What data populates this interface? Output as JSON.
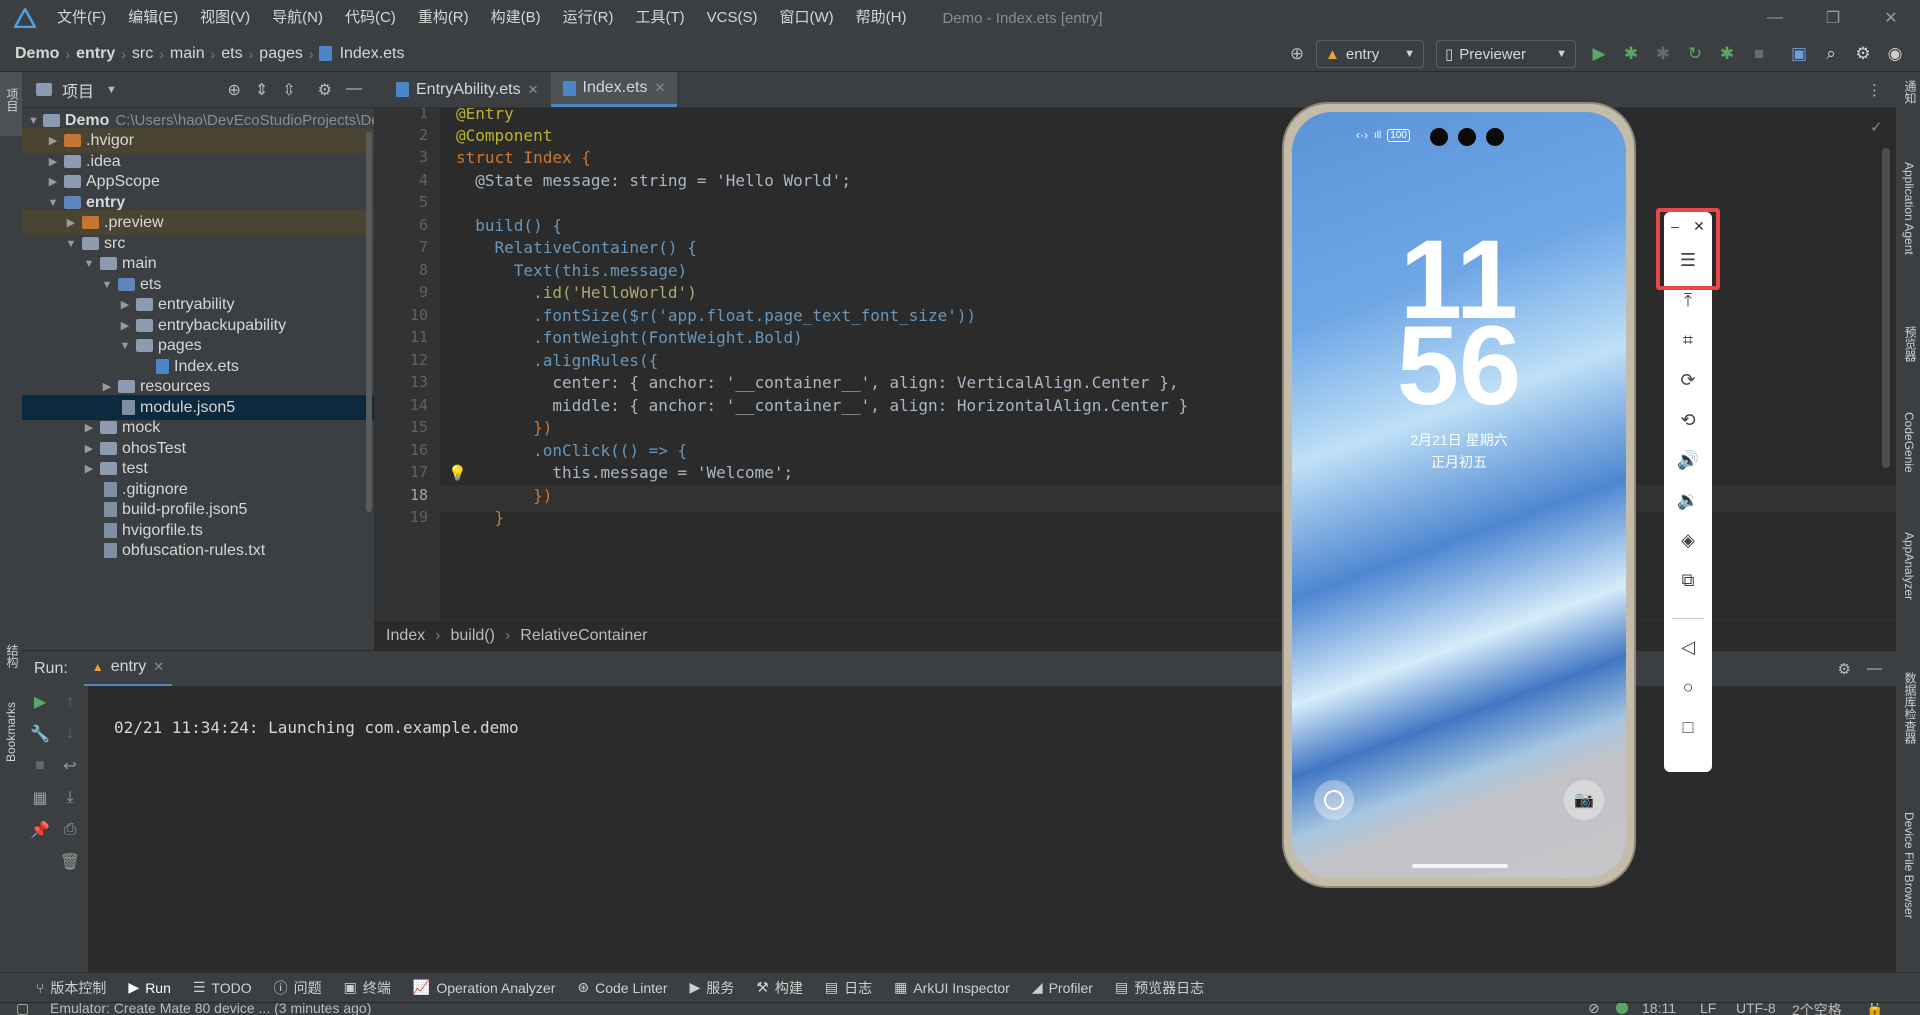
{
  "titlebar": {
    "menu": [
      "文件(F)",
      "编辑(E)",
      "视图(V)",
      "导航(N)",
      "代码(C)",
      "重构(R)",
      "构建(B)",
      "运行(R)",
      "工具(T)",
      "VCS(S)",
      "窗口(W)",
      "帮助(H)"
    ],
    "window_title": "Demo - Index.ets [entry]"
  },
  "navbar": {
    "crumbs": [
      "Demo",
      "entry",
      "src",
      "main",
      "ets",
      "pages",
      "Index.ets"
    ],
    "module": "entry",
    "device": "Previewer"
  },
  "project": {
    "title": "项目",
    "tree": [
      {
        "name": "Demo",
        "path": "C:\\Users\\hao\\DevEcoStudioProjects\\Demo"
      },
      {
        "name": ".hvigor"
      },
      {
        "name": ".idea"
      },
      {
        "name": "AppScope"
      },
      {
        "name": "entry"
      },
      {
        "name": ".preview"
      },
      {
        "name": "src"
      },
      {
        "name": "main"
      },
      {
        "name": "ets"
      },
      {
        "name": "entryability"
      },
      {
        "name": "entrybackupability"
      },
      {
        "name": "pages"
      },
      {
        "name": "Index.ets"
      },
      {
        "name": "resources"
      },
      {
        "name": "module.json5"
      },
      {
        "name": "mock"
      },
      {
        "name": "ohosTest"
      },
      {
        "name": "test"
      },
      {
        "name": ".gitignore"
      },
      {
        "name": "build-profile.json5"
      },
      {
        "name": "hvigorfile.ts"
      },
      {
        "name": "obfuscation-rules.txt"
      }
    ]
  },
  "tabs": [
    "EntryAbility.ets",
    "Index.ets"
  ],
  "code": {
    "line_numbers": [
      "1",
      "2",
      "3",
      "4",
      "5",
      "6",
      "7",
      "8",
      "9",
      "10",
      "11",
      "12",
      "13",
      "14",
      "15",
      "16",
      "17",
      "18",
      "19"
    ],
    "lines": [
      "@Entry",
      "@Component",
      "struct Index {",
      "  @State message: string = 'Hello World';",
      "",
      "  build() {",
      "    RelativeContainer() {",
      "      Text(this.message)",
      "        .id('HelloWorld')",
      "        .fontSize($r('app.float.page_text_font_size'))",
      "        .fontWeight(FontWeight.Bold)",
      "        .alignRules({",
      "          center: { anchor: '__container__', align: VerticalAlign.Center },",
      "          middle: { anchor: '__container__', align: HorizontalAlign.Center }",
      "        })",
      "        .onClick(() => {",
      "          this.message = 'Welcome';",
      "        })",
      "    }"
    ]
  },
  "breadcrumb": [
    "Index",
    "build()",
    "RelativeContainer"
  ],
  "run": {
    "label": "Run:",
    "tab": "entry",
    "console": "02/21 11:34:24: Launching com.example.demo"
  },
  "phone": {
    "hour": "11",
    "minute": "56",
    "date": "2月21日 星期六",
    "lunar": "正月初五",
    "battery": "100"
  },
  "right_tools": [
    "通知",
    "Application Agent",
    "预览器",
    "CodeGenie",
    "AppAnalyzer",
    "数据库检查器",
    "Device File Browser"
  ],
  "left_tools": [
    "项目",
    "结构",
    "Bookmarks"
  ],
  "bottom_tools": [
    "版本控制",
    "Run",
    "TODO",
    "问题",
    "终端",
    "Operation Analyzer",
    "Code Linter",
    "服务",
    "构建",
    "日志",
    "ArkUI Inspector",
    "Profiler",
    "预览器日志"
  ],
  "status": {
    "message": "Emulator: Create Mate 80 device ... (3 minutes ago)",
    "position": "18:11",
    "line_sep": "LF",
    "encoding": "UTF-8",
    "indent": "2个空格"
  }
}
